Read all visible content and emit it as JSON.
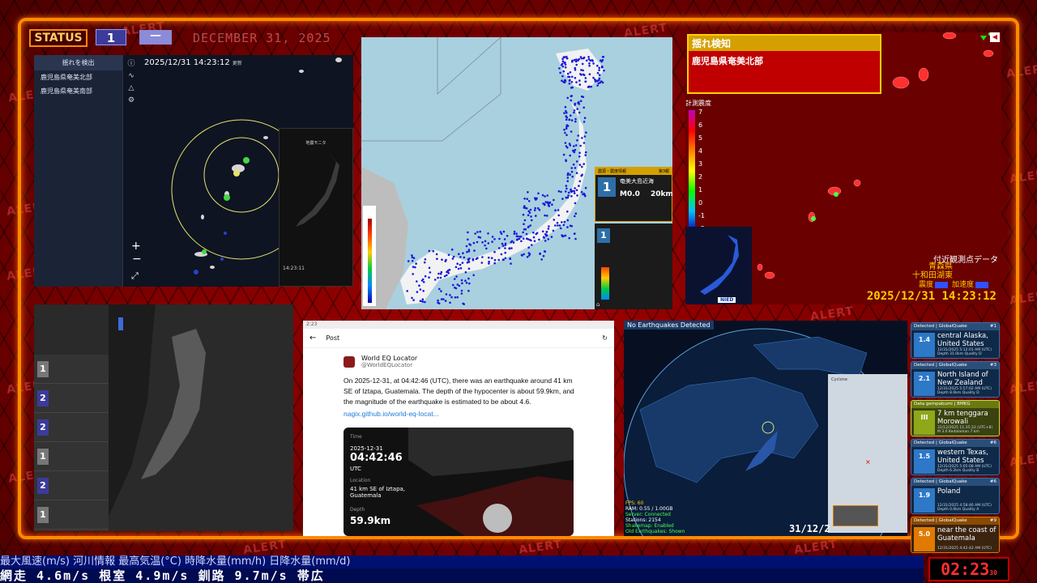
{
  "status": {
    "label": "STATUS",
    "level": "1",
    "dash": "一",
    "date_watermark": "DECEMBER 31, 2025"
  },
  "alert_watermark": "ALERT",
  "panel1": {
    "sidebar_title": "揺れを検出",
    "regions": [
      "鹿児島県奄美北部",
      "鹿児島県奄美南部"
    ],
    "datetime": "2025/12/31  14:23:12",
    "datetime_suffix": "更新",
    "phone_title": "地震モニタ",
    "phone_time": "14:23:11",
    "zoom_in": "+",
    "zoom_out": "−"
  },
  "panel2": {
    "info_header": "震源・震度情報",
    "info_report": "第3報",
    "intensity": "1",
    "region": "奄美大島近海",
    "magnitude": "M0.0",
    "depth": "20km",
    "sub_intensity": "1"
  },
  "panel3": {
    "alert_title": "揺れ検知",
    "alert_region": "鹿児島県奄美北部",
    "scale_label": "計測震度",
    "scale_ticks": [
      "7",
      "6",
      "5",
      "4",
      "3",
      "2",
      "1",
      "0",
      "-1",
      "-2"
    ],
    "nearby_title": "付近観測点データ",
    "pref": "青森県",
    "station": "十和田湖東",
    "legend_intensity": "震度",
    "legend_accel": "加速度",
    "timestamp": "2025/12/31 14:23:12",
    "nied": "NIED"
  },
  "panel4": {
    "rows": [
      {
        "num": "1",
        "color": "#777"
      },
      {
        "num": "2",
        "color": "#3b3b9a"
      },
      {
        "num": "2",
        "color": "#3b3b9a"
      },
      {
        "num": "1",
        "color": "#777"
      },
      {
        "num": "2",
        "color": "#3b3b9a"
      },
      {
        "num": "1",
        "color": "#777"
      }
    ]
  },
  "panel5": {
    "status_time": "2:23",
    "header": "Post",
    "user_name": "World EQ Locator",
    "user_handle": "@WorldEQLocator",
    "body": "On 2025-12-31, at 04:42:46 (UTC), there was an earthquake around 41 km SE of Iztapa, Guatemala. The depth of the hypocenter is about 59.9km, and the magnitude of the earthquake is estimated to be about 4.6.",
    "link": "nagix.github.io/world-eq-locat...",
    "card_time_label": "Time",
    "card_date": "2025-12-31",
    "card_time": "04:42:46",
    "card_tz": "UTC",
    "card_location_label": "Location",
    "card_location": "41 km SE of Iztapa, Guatemala",
    "card_depth_label": "Depth",
    "card_depth": "59.9km"
  },
  "panel6": {
    "header": "No Earthquakes Detected",
    "stats": [
      "FPS: 60",
      "RAM: 0.55 / 1.00GB",
      "Server: Connected",
      "Stations: 2154",
      "Shakemap: Enabled",
      "Old Earthquakes: Shown"
    ],
    "date": "31/12/2"
  },
  "quake_cards": [
    {
      "source": "Detected | GlobalQuake",
      "id": "#1",
      "mag": "1.4",
      "place": "central Alaska, United States",
      "meta": "12/31/2025 5:12:01 AM (UTC)",
      "meta2": "Depth 31.0km  Quality D",
      "color": "#2e78c8"
    },
    {
      "source": "Detected | GlobalQuake",
      "id": "#3",
      "mag": "2.1",
      "place": "North Island of New Zealand",
      "meta": "12/31/2025 5:57:02 AM (UTC)",
      "meta2": "Depth 8.0km  Quality D",
      "color": "#2e78c8"
    },
    {
      "source": "Data gempabumi | BMKG",
      "id": "",
      "mag": "III",
      "place": "7 km tenggara Morowali",
      "meta": "31/12/2025 11:35:33 (UTC+8)",
      "meta2": "M 3.0  Kedalaman 7 km",
      "color": "#8fa81a"
    },
    {
      "source": "Detected | GlobalQuake",
      "id": "#6",
      "mag": "1.5",
      "place": "western Texas, United States",
      "meta": "12/31/2025 5:05:08 AM (UTC)",
      "meta2": "Depth 6.2km  Quality B",
      "color": "#2e78c8"
    },
    {
      "source": "Detected | GlobalQuake",
      "id": "#6",
      "mag": "1.9",
      "place": "Poland",
      "meta": "12/31/2025 4:58:46 AM (UTC)",
      "meta2": "Depth 0.0km  Quality A",
      "color": "#2e78c8"
    },
    {
      "source": "Detected | GlobalQuake",
      "id": "#9",
      "mag": "5.0",
      "place": "near the coast of Guatemala",
      "meta": "12/31/2025 4:42:42 AM (UTC)",
      "meta2": "",
      "color": "#e07a00"
    }
  ],
  "ticker": {
    "line1": "最大風速(m/s)  河川情報      最高気温(°C)      時降水量(mm/h)    日降水量(mm/d)",
    "line2": "  網走  4.6m/s    根室  4.9m/s    釧路  9.7m/s    帯広",
    "clock": "02:23",
    "clock_sec": "30"
  }
}
